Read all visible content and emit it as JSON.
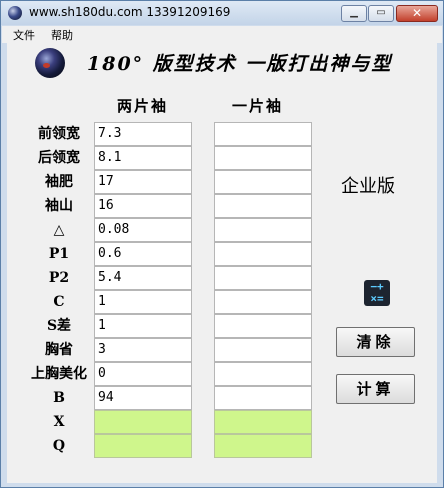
{
  "window": {
    "title": "www.sh180du.com    13391209169",
    "controls": {
      "minimize": "▁",
      "maximize": "▭",
      "close": "✕"
    }
  },
  "menu": {
    "items": [
      "文件",
      "帮助"
    ]
  },
  "header": {
    "heading": "180°  版型技术 一版打出神与型"
  },
  "columns": {
    "col1": "两片袖",
    "col2": "一片袖"
  },
  "rows": [
    {
      "label": "前领宽",
      "col1": "7.3",
      "col2": ""
    },
    {
      "label": "后领宽",
      "col1": "8.1",
      "col2": ""
    },
    {
      "label": "袖肥",
      "col1": "17",
      "col2": ""
    },
    {
      "label": "袖山",
      "col1": "16",
      "col2": ""
    },
    {
      "label": "△",
      "col1": "0.08",
      "col2": ""
    },
    {
      "label": "P1",
      "col1": "0.6",
      "col2": ""
    },
    {
      "label": "P2",
      "col1": "5.4",
      "col2": ""
    },
    {
      "label": "C",
      "col1": "1",
      "col2": ""
    },
    {
      "label": "S差",
      "col1": "1",
      "col2": ""
    },
    {
      "label": "胸省",
      "col1": "3",
      "col2": ""
    },
    {
      "label": "上胸美化",
      "col1": "0",
      "col2": ""
    },
    {
      "label": "B",
      "col1": "94",
      "col2": ""
    }
  ],
  "result_rows": [
    {
      "label": "X",
      "col1": "",
      "col2": ""
    },
    {
      "label": "Q",
      "col1": "",
      "col2": ""
    }
  ],
  "side": {
    "edition": "企业版",
    "calc_icon": "calculator-icon",
    "clear_button": "清除",
    "calc_button": "计算"
  },
  "colors": {
    "result_cell": "#cff68c",
    "title_bar": "#cfdcec"
  }
}
